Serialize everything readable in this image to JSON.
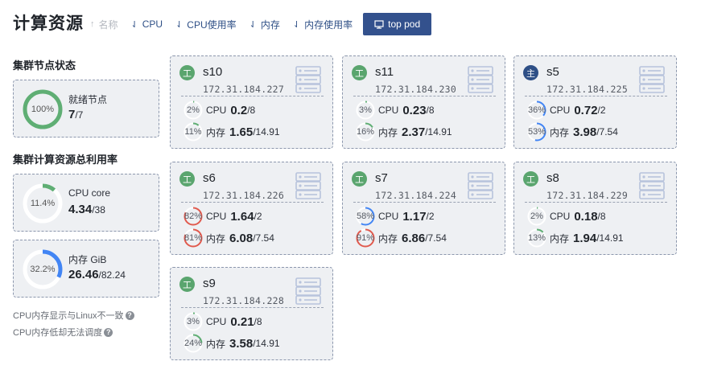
{
  "page_title": "计算资源",
  "sort_bar": {
    "items": [
      {
        "label": "名称",
        "arrow": "↑",
        "enabled": false
      },
      {
        "label": "CPU",
        "arrow": "⇃",
        "enabled": true
      },
      {
        "label": "CPU使用率",
        "arrow": "⇃",
        "enabled": true
      },
      {
        "label": "内存",
        "arrow": "⇃",
        "enabled": true
      },
      {
        "label": "内存使用率",
        "arrow": "⇃",
        "enabled": true
      }
    ],
    "top_pod_label": "top pod"
  },
  "cluster_status": {
    "title": "集群节点状态",
    "ring_text": "100%",
    "ring_fraction": 1.0,
    "label": "就绪节点",
    "value": "7",
    "total": "/7"
  },
  "cluster_usage": {
    "title": "集群计算资源总利用率",
    "cpu": {
      "ring_text": "11.4%",
      "ring_fraction": 0.114,
      "label": "CPU core",
      "value": "4.34",
      "total": "/38"
    },
    "mem": {
      "ring_text": "32.2%",
      "ring_fraction": 0.322,
      "label": "内存 GiB",
      "value": "26.46",
      "total": "/82.24"
    }
  },
  "notes": [
    "CPU内存显示与Linux不一致",
    "CPU内存低却无法调度"
  ],
  "colors": {
    "worker_badge": "#5aa56e",
    "master_badge": "#2e4f86",
    "ring_green": "#5fae74",
    "ring_blue": "#4285f4",
    "ring_red": "#e05a4e",
    "ring_track": "#ffffff",
    "server_icon": "#b7c3dc"
  },
  "nodes": [
    {
      "badge": "工",
      "role": "worker",
      "name": "s10",
      "ip": "172.31.184.227",
      "cpu": {
        "pct": "2%",
        "frac": 0.02,
        "label": "CPU",
        "used": "0.2",
        "total": "/8"
      },
      "mem": {
        "pct": "11%",
        "frac": 0.11,
        "label": "内存",
        "used": "1.65",
        "total": "/14.91"
      }
    },
    {
      "badge": "工",
      "role": "worker",
      "name": "s11",
      "ip": "172.31.184.230",
      "cpu": {
        "pct": "3%",
        "frac": 0.03,
        "label": "CPU",
        "used": "0.23",
        "total": "/8"
      },
      "mem": {
        "pct": "16%",
        "frac": 0.16,
        "label": "内存",
        "used": "2.37",
        "total": "/14.91"
      }
    },
    {
      "badge": "主",
      "role": "master",
      "name": "s5",
      "ip": "172.31.184.225",
      "cpu": {
        "pct": "36%",
        "frac": 0.36,
        "label": "CPU",
        "used": "0.72",
        "total": "/2"
      },
      "mem": {
        "pct": "53%",
        "frac": 0.53,
        "label": "内存",
        "used": "3.98",
        "total": "/7.54"
      }
    },
    {
      "badge": "工",
      "role": "worker",
      "name": "s6",
      "ip": "172.31.184.226",
      "cpu": {
        "pct": "82%",
        "frac": 0.82,
        "label": "CPU",
        "used": "1.64",
        "total": "/2"
      },
      "mem": {
        "pct": "81%",
        "frac": 0.81,
        "label": "内存",
        "used": "6.08",
        "total": "/7.54"
      }
    },
    {
      "badge": "工",
      "role": "worker",
      "name": "s7",
      "ip": "172.31.184.224",
      "cpu": {
        "pct": "58%",
        "frac": 0.58,
        "label": "CPU",
        "used": "1.17",
        "total": "/2"
      },
      "mem": {
        "pct": "91%",
        "frac": 0.91,
        "label": "内存",
        "used": "6.86",
        "total": "/7.54"
      }
    },
    {
      "badge": "工",
      "role": "worker",
      "name": "s8",
      "ip": "172.31.184.229",
      "cpu": {
        "pct": "2%",
        "frac": 0.02,
        "label": "CPU",
        "used": "0.18",
        "total": "/8"
      },
      "mem": {
        "pct": "13%",
        "frac": 0.13,
        "label": "内存",
        "used": "1.94",
        "total": "/14.91"
      }
    },
    {
      "badge": "工",
      "role": "worker",
      "name": "s9",
      "ip": "172.31.184.228",
      "cpu": {
        "pct": "3%",
        "frac": 0.03,
        "label": "CPU",
        "used": "0.21",
        "total": "/8"
      },
      "mem": {
        "pct": "24%",
        "frac": 0.24,
        "label": "内存",
        "used": "3.58",
        "total": "/14.91"
      }
    }
  ]
}
